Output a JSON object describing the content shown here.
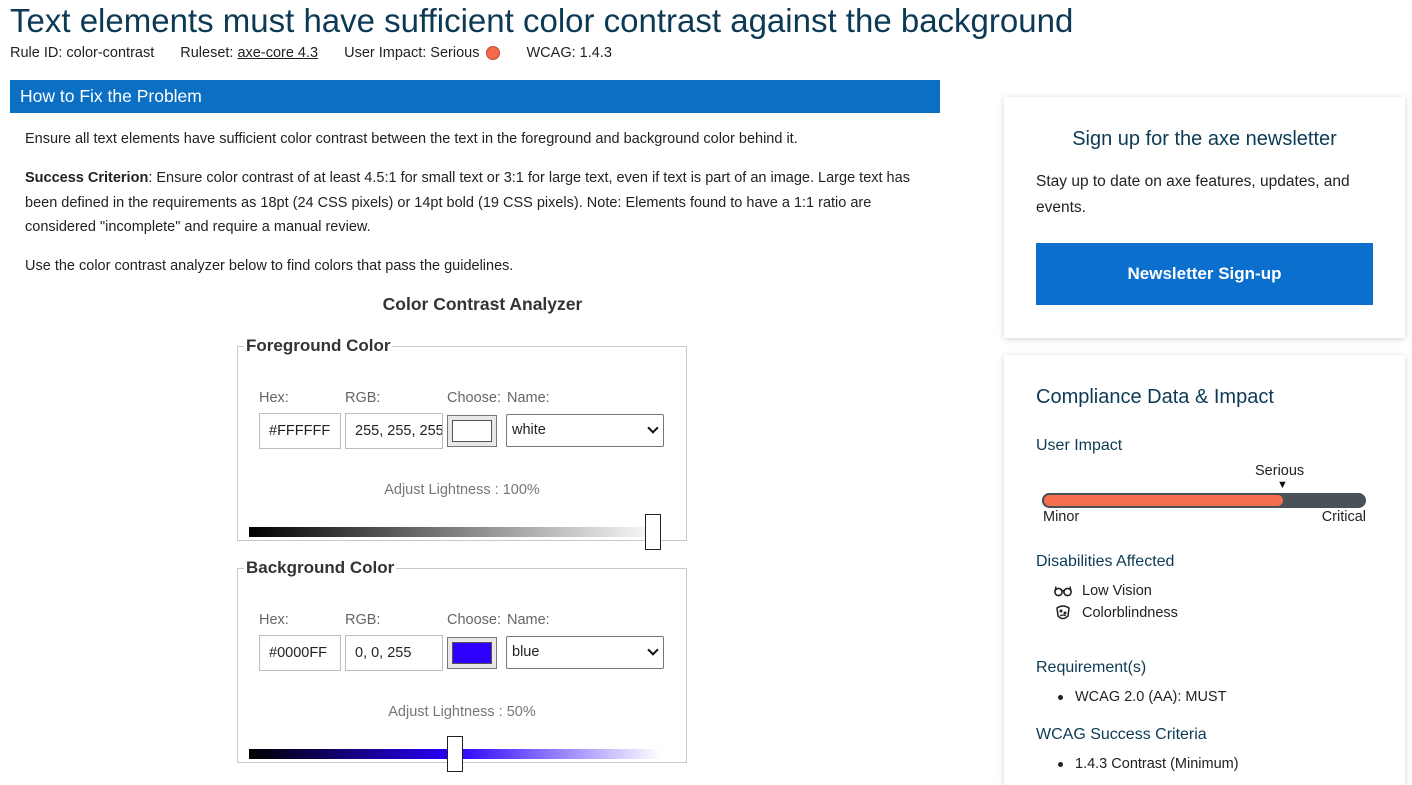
{
  "rule": {
    "title": "Text elements must have sufficient color contrast against the background",
    "rule_id_text": "Rule ID: color-contrast",
    "ruleset_label": "Ruleset:",
    "ruleset_link": "axe-core 4.3",
    "user_impact_text": "User Impact: Serious",
    "impact_color": "#f2694e",
    "wcag_text": "WCAG: 1.4.3"
  },
  "fix": {
    "header": "How to Fix the Problem",
    "intro": "Ensure all text elements have sufficient color contrast between the text in the foreground and background color behind it.",
    "criterion_label": "Success Criterion",
    "criterion_text": ": Ensure color contrast of at least 4.5:1 for small text or 3:1 for large text, even if text is part of an image. Large text has been defined in the requirements as 18pt (24 CSS pixels) or 14pt bold (19 CSS pixels). Note: Elements found to have a 1:1 ratio are considered \"incomplete\" and require a manual review.",
    "analyzer_hint": "Use the color contrast analyzer below to find colors that pass the guidelines."
  },
  "analyzer": {
    "title": "Color Contrast Analyzer",
    "labels": {
      "hex": "Hex:",
      "rgb": "RGB:",
      "choose": "Choose:",
      "name": "Name:"
    },
    "foreground": {
      "legend": "Foreground Color",
      "hex": "#FFFFFF",
      "rgb": "255, 255, 255",
      "swatch_color": "#ffffff",
      "name": "white",
      "lightness_label": "Adjust Lightness : 100%",
      "lightness_value": 1.0,
      "gradient": [
        "#000000",
        "#ffffff"
      ]
    },
    "background": {
      "legend": "Background Color",
      "hex": "#0000FF",
      "rgb": "0, 0, 255",
      "swatch_color": "#2f00ff",
      "name": "blue",
      "lightness_label": "Adjust Lightness : 50%",
      "lightness_value": 0.5,
      "gradient": [
        "#000000",
        "#2a00ff",
        "#ffffff"
      ]
    }
  },
  "newsletter": {
    "title": "Sign up for the axe newsletter",
    "text": "Stay up to date on axe features, updates, and events.",
    "button": "Newsletter Sign-up"
  },
  "compliance": {
    "title": "Compliance Data & Impact",
    "user_impact_label": "User Impact",
    "impact_level": "Serious",
    "impact_value": 0.75,
    "impact_min": "Minor",
    "impact_max": "Critical",
    "disabilities_label": "Disabilities Affected",
    "disabilities": [
      {
        "label": "Low Vision",
        "icon": "glasses-icon"
      },
      {
        "label": "Colorblindness",
        "icon": "color-eye-icon"
      }
    ],
    "requirements_label": "Requirement(s)",
    "requirements": [
      "WCAG 2.0 (AA): MUST"
    ],
    "criteria_label": "WCAG Success Criteria",
    "criteria": [
      "1.4.3 Contrast (Minimum)"
    ]
  }
}
